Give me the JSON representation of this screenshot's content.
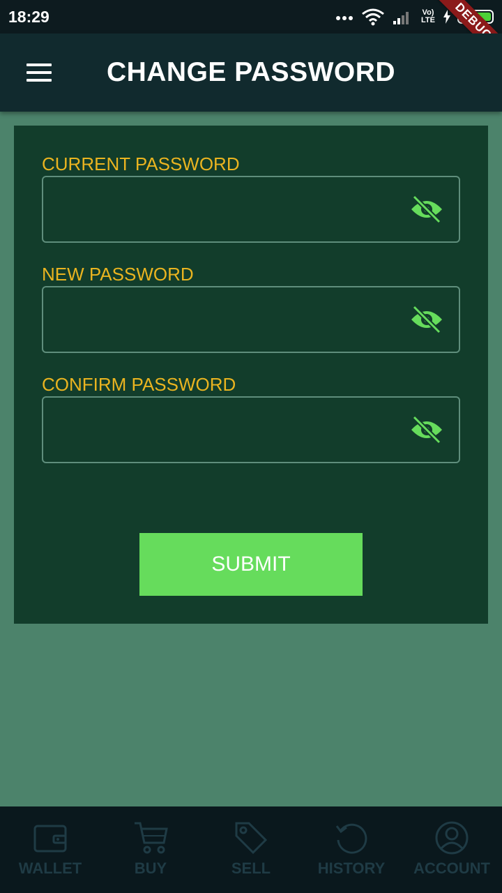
{
  "status_bar": {
    "time": "18:29",
    "network_label": "Vo) LTE",
    "debug_label": "DEBUG"
  },
  "app_bar": {
    "title": "CHANGE PASSWORD",
    "menu_icon": "hamburger-menu-icon"
  },
  "form": {
    "fields": [
      {
        "label": "CURRENT PASSWORD",
        "value": "",
        "visibility_icon": "eye-off-icon"
      },
      {
        "label": "NEW PASSWORD",
        "value": "",
        "visibility_icon": "eye-off-icon"
      },
      {
        "label": "CONFIRM PASSWORD",
        "value": "",
        "visibility_icon": "eye-off-icon"
      }
    ],
    "submit_label": "SUBMIT"
  },
  "bottom_nav": {
    "items": [
      {
        "label": "WALLET",
        "icon": "wallet-icon"
      },
      {
        "label": "BUY",
        "icon": "cart-icon"
      },
      {
        "label": "SELL",
        "icon": "tag-icon"
      },
      {
        "label": "HISTORY",
        "icon": "history-icon"
      },
      {
        "label": "ACCOUNT",
        "icon": "account-icon"
      }
    ]
  },
  "colors": {
    "page_background": "#4c836b",
    "app_bar": "#112a2e",
    "card": "#123d2b",
    "label": "#eab420",
    "accent": "#66dc5c",
    "nav_background": "#0a181d",
    "nav_inactive": "#1f3b45"
  }
}
